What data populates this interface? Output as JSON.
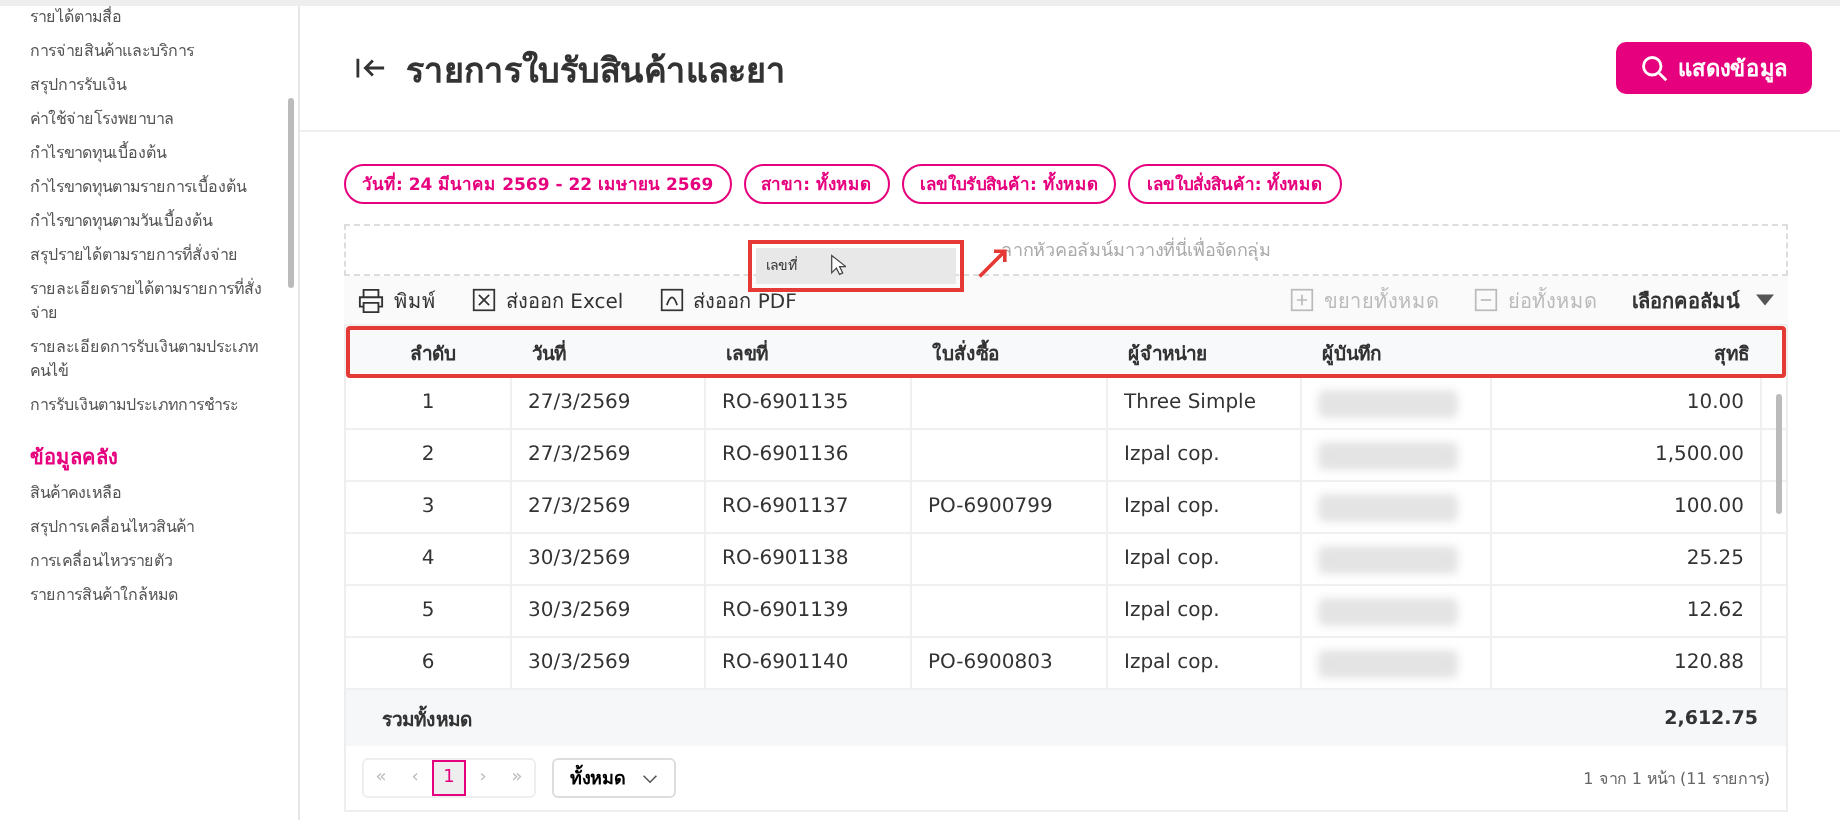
{
  "sidebar": {
    "items": [
      {
        "label": "รายได้ตามสื่อ",
        "kind": "item"
      },
      {
        "label": "การจ่ายสินค้าและบริการ",
        "kind": "item"
      },
      {
        "label": "สรุปการรับเงิน",
        "kind": "item"
      },
      {
        "label": "ค่าใช้จ่ายโรงพยาบาล",
        "kind": "item"
      },
      {
        "label": "กำไรขาดทุนเบื้องต้น",
        "kind": "item"
      },
      {
        "label": "กำไรขาดทุนตามรายการเบื้องต้น",
        "kind": "item"
      },
      {
        "label": "กำไรขาดทุนตามวันเบื้องต้น",
        "kind": "item"
      },
      {
        "label": "สรุปรายได้ตามรายการที่สั่งจ่าย",
        "kind": "item"
      },
      {
        "label": "รายละเอียดรายได้ตามรายการที่สั่งจ่าย",
        "kind": "item"
      },
      {
        "label": "รายละเอียดการรับเงินตามประเภทคนไข้",
        "kind": "item"
      },
      {
        "label": "การรับเงินตามประเภทการชำระ",
        "kind": "item"
      },
      {
        "label": "ข้อมูลคลัง",
        "kind": "heading"
      },
      {
        "label": "สินค้าคงเหลือ",
        "kind": "item"
      },
      {
        "label": "สรุปการเคลื่อนไหวสินค้า",
        "kind": "item"
      },
      {
        "label": "การเคลื่อนไหวรายตัว",
        "kind": "item"
      },
      {
        "label": "รายการสินค้าใกล้หมด",
        "kind": "item"
      }
    ]
  },
  "header": {
    "title": "รายการใบรับสินค้าและยา",
    "button": "แสดงข้อมูล"
  },
  "filters": [
    "วันที่: 24 มีนาคม 2569 - 22 เมษายน 2569",
    "สาขา: ทั้งหมด",
    "เลขใบรับสินค้า: ทั้งหมด",
    "เลขใบสั่งสินค้า: ทั้งหมด"
  ],
  "group_zone": {
    "placeholder": "ลากหัวคอลัมน์มาวางที่นี่เพื่อจัดกลุ่ม",
    "drag_ghost": "เลขที่"
  },
  "toolbar": [
    {
      "label": "พิมพ์",
      "kind": "print",
      "disabled": false
    },
    {
      "label": "ส่งออก Excel",
      "kind": "excel",
      "disabled": false
    },
    {
      "label": "ส่งออก PDF",
      "kind": "pdf",
      "disabled": false
    },
    {
      "label": "ขยายทั้งหมด",
      "kind": "expand",
      "disabled": true
    },
    {
      "label": "ย่อทั้งหมด",
      "kind": "collapse",
      "disabled": true
    }
  ],
  "column_chooser": "เลือกคอลัมน์",
  "table": {
    "columns": [
      "ลำดับ",
      "วันที่",
      "เลขที่",
      "ใบสั่งซื้อ",
      "ผู้จำหน่าย",
      "ผู้บันทึก",
      "สุทธิ"
    ],
    "rows": [
      [
        "1",
        "27/3/2569",
        "RO-6901135",
        "",
        "Three Simple",
        null,
        "10.00"
      ],
      [
        "2",
        "27/3/2569",
        "RO-6901136",
        "",
        "Izpal cop.",
        null,
        "1,500.00"
      ],
      [
        "3",
        "27/3/2569",
        "RO-6901137",
        "PO-6900799",
        "Izpal cop.",
        null,
        "100.00"
      ],
      [
        "4",
        "30/3/2569",
        "RO-6901138",
        "",
        "Izpal cop.",
        null,
        "25.25"
      ],
      [
        "5",
        "30/3/2569",
        "RO-6901139",
        "",
        "Izpal cop.",
        null,
        "12.62"
      ],
      [
        "6",
        "30/3/2569",
        "RO-6901140",
        "PO-6900803",
        "Izpal cop.",
        null,
        "120.88"
      ]
    ],
    "total_label": "รวมทั้งหมด",
    "total_value": "2,612.75"
  },
  "pagination": {
    "buttons": [
      {
        "label": "«",
        "selected": false
      },
      {
        "label": "‹",
        "selected": false
      },
      {
        "label": "1",
        "selected": true
      },
      {
        "label": "›",
        "selected": false
      },
      {
        "label": "»",
        "selected": false
      }
    ],
    "page_size": "ทั้งหมด",
    "summary": "1 จาก 1 หน้า (11 รายการ)"
  }
}
